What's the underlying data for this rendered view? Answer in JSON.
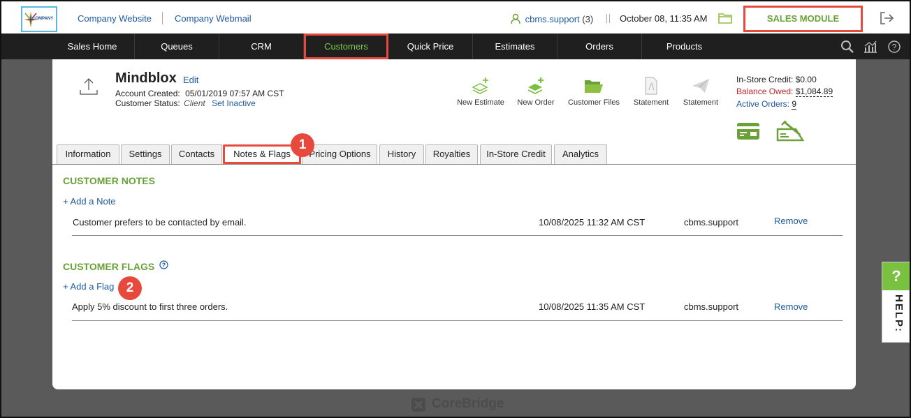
{
  "top": {
    "logo_text": "COMPANY",
    "website_link": "Company Website",
    "webmail_link": "Company Webmail",
    "user_name": "cbms.support",
    "user_count": "(3)",
    "datetime": "October 08, 11:35 AM",
    "module_label": "SALES MODULE"
  },
  "nav": {
    "items": [
      "Sales Home",
      "Queues",
      "CRM",
      "Customers",
      "Quick Price",
      "Estimates",
      "Orders",
      "Products"
    ],
    "active": "Customers"
  },
  "customer": {
    "name": "Mindblox",
    "edit_label": "Edit",
    "created_label": "Account Created:",
    "created_value": "05/01/2019 07:57 AM CST",
    "status_label": "Customer Status:",
    "status_value": "Client",
    "set_inactive": "Set Inactive"
  },
  "actions": [
    "New Estimate",
    "New Order",
    "Customer Files",
    "Statement",
    "Statement"
  ],
  "credit": {
    "instore_label": "In-Store Credit:",
    "instore_value": "$0.00",
    "balance_label": "Balance Owed:",
    "balance_value": "$1,084.89",
    "orders_label": "Active Orders:",
    "orders_value": "9"
  },
  "tabs": [
    "Information",
    "Settings",
    "Contacts",
    "Notes & Flags",
    "Pricing Options",
    "History",
    "Royalties",
    "In-Store Credit",
    "Analytics"
  ],
  "badges": [
    "1",
    "2"
  ],
  "notes": {
    "title": "CUSTOMER NOTES",
    "add_label": "+ Add a Note",
    "rows": [
      {
        "text": "Customer prefers to be contacted by email.",
        "date": "10/08/2025 11:32 AM CST",
        "user": "cbms.support",
        "action": "Remove"
      }
    ]
  },
  "flags": {
    "title": "CUSTOMER FLAGS",
    "add_label": "+ Add a Flag",
    "rows": [
      {
        "text": "Apply 5% discount to first three orders.",
        "date": "10/08/2025 11:35 AM CST",
        "user": "cbms.support",
        "action": "Remove"
      }
    ]
  },
  "footer": {
    "brand": "CoreBridge"
  },
  "help": {
    "q": "?",
    "label": "HELP:"
  }
}
